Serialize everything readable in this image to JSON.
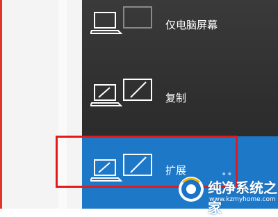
{
  "projection_menu": {
    "options": [
      {
        "label": "仅电脑屏幕",
        "icon": "pc-screen-only-icon",
        "selected": false
      },
      {
        "label": "复制",
        "icon": "duplicate-icon",
        "selected": false
      },
      {
        "label": "扩展",
        "icon": "extend-icon",
        "selected": true
      }
    ]
  },
  "annotation": {
    "highlight_color": "#e21a1a"
  },
  "colors": {
    "panel_bg": "#2d2d2d",
    "selected_bg": "#1e78c8",
    "accent_red": "#e2362a"
  },
  "watermark": {
    "title": "纯净系统之家",
    "url": "www.kzmyhome.com"
  }
}
